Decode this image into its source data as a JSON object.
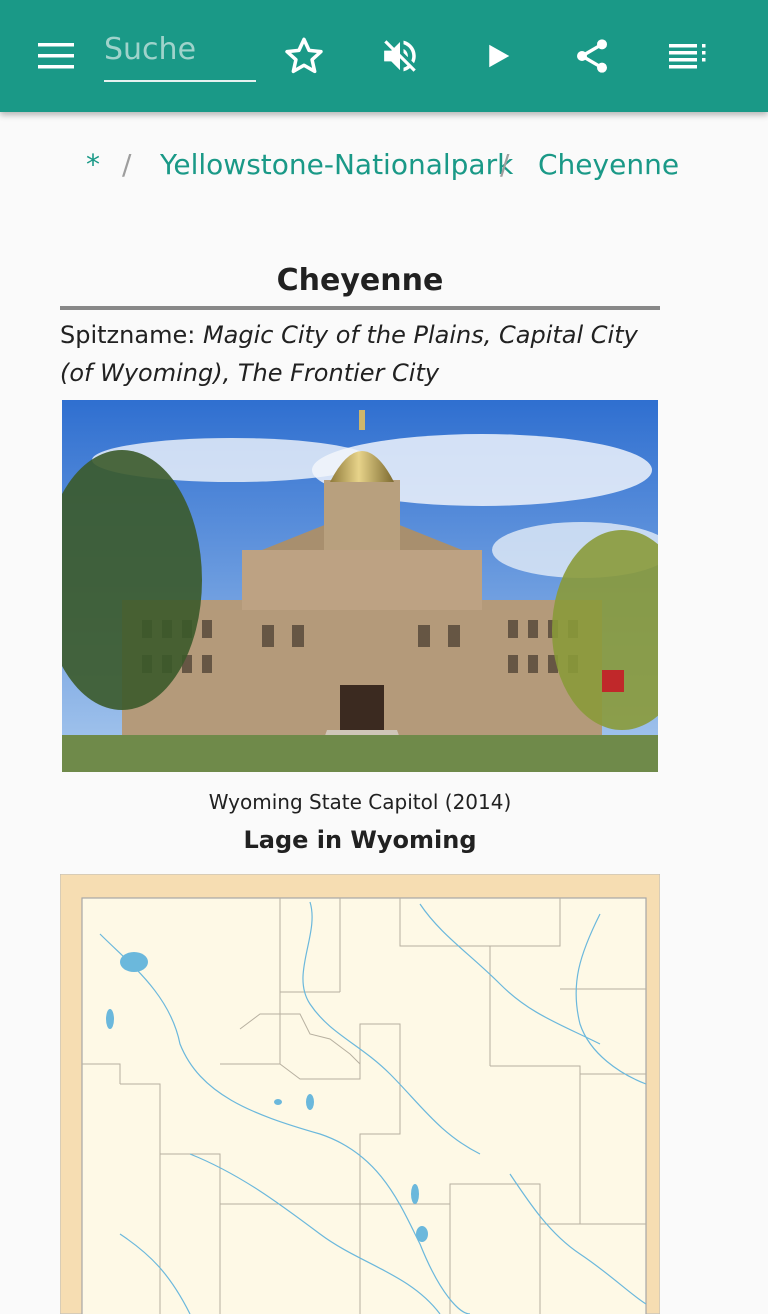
{
  "toolbar": {
    "menu_icon": "hamburger-menu-icon",
    "search_placeholder": "Suche",
    "search_value": "",
    "favorite_icon": "star-outline-icon",
    "mute_icon": "volume-off-icon",
    "play_icon": "play-icon",
    "share_icon": "share-icon",
    "toc_icon": "table-of-contents-icon"
  },
  "breadcrumb": [
    "*",
    "Yellowstone-Nationalpark",
    "Cheyenne"
  ],
  "breadcrumb_separator": "/",
  "article": {
    "title": "Cheyenne",
    "nickname_label": "Spitzname:",
    "nickname_value": "Magic City of the Plains, Capital City (of Wyoming), The Frontier City",
    "photo_caption": "Wyoming State Capitol (2014)",
    "map_heading": "Lage in Wyoming"
  },
  "colors": {
    "accent": "#1a9987",
    "link": "#1a9987",
    "background": "#fafafa",
    "map_land": "#fef9e6",
    "map_border": "#f6ddb2",
    "map_water": "#6bb8dc"
  }
}
